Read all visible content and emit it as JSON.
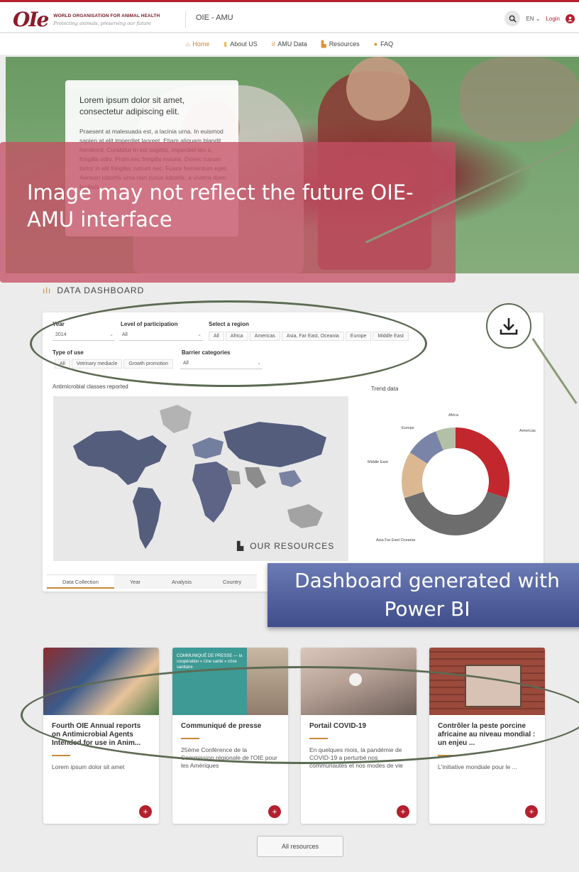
{
  "header": {
    "org_name": "WORLD ORGANISATION FOR ANIMAL HEALTH",
    "tagline": "Protecting animals, preserving our future",
    "app_name": "OIE - AMU",
    "language": "EN",
    "login_label": "Login"
  },
  "nav": {
    "items": [
      {
        "label": "Home",
        "icon": "home-icon"
      },
      {
        "label": "About US",
        "icon": "info-icon"
      },
      {
        "label": "AMU Data",
        "icon": "bar-chart-icon"
      },
      {
        "label": "Resources",
        "icon": "book-icon"
      },
      {
        "label": "FAQ",
        "icon": "question-icon"
      }
    ]
  },
  "hero": {
    "heading": "Lorem ipsum dolor sit amet, consectetur adipiscing elit.",
    "body": "Praesent at malesuada est, a lacinia urna. In euismod sapien at elit imperdiet laoreet. Etiam aliquam blandit hendrerit. Curabitur in est sagittis, imperdiet leo a, fringilla odio. Proin nec fringilla mauris. Donec rutrum tortor in elit fringilla, rutrum nec. Fusce fermentum eget. Aenean lobortis urna non purus lobortis, a viverra diam facilisis."
  },
  "overlay_note": "Image may not reflect the future OIE-AMU interface",
  "dashboard": {
    "title": "DATA DASHBOARD",
    "filters": {
      "year_label": "Year",
      "year_value": "2014",
      "participation_label": "Level of participation",
      "participation_value": "All",
      "region_label": "Select a region",
      "regions": [
        "All",
        "Africa",
        "Americas",
        "Asia, Far East, Oceania",
        "Europe",
        "Middle East"
      ],
      "use_label": "Type of use",
      "uses": [
        "All",
        "Vetrinary mediacle",
        "Growth promotion"
      ],
      "barrier_label": "Barrier categories",
      "barrier_value": "All"
    },
    "map_label": "Antimicrobial classes reported",
    "trend_label": "Trend data",
    "tabs": [
      "Data Collection",
      "Year",
      "Analysis",
      "Country"
    ],
    "active_tab": "Data Collection"
  },
  "banner_note": "Dashboard generated with Power BI",
  "resources": {
    "title": "OUR RESOURCES",
    "cards": [
      {
        "title": "Fourth OIE Annual reports on Antimicrobial Agents Intended for use in Anim...",
        "desc": "Lorem ipsum dolor sit amet"
      },
      {
        "title": "Communiqué de presse",
        "desc": "25ème Conférence de la Commission régionale de l'OIE pour les Amériques",
        "img_caption": "COMMUNIQUÉ DE PRESSE — la coopération « Une santé » crise sanitaire"
      },
      {
        "title": "Portail COVID-19",
        "desc": "En quelques mois, la pandémie de COVID-19 a perturbé nos communautés et nos modes de vie"
      },
      {
        "title": "Contrôler la peste porcine africaine au niveau mondial : un enjeu ...",
        "desc": "L'initiative mondiale pour le ..."
      }
    ],
    "all_label": "All resources"
  },
  "chart_data": {
    "type": "pie",
    "title": "Trend data",
    "categories": [
      "Americas",
      "Asia Far East Oceania",
      "Middle East",
      "Europe",
      "Africa"
    ],
    "values": [
      30,
      40,
      14,
      10,
      6
    ],
    "colors": [
      "#c1272d",
      "#6d6d6d",
      "#dcb892",
      "#7a84a8",
      "#b3bfa6"
    ]
  }
}
